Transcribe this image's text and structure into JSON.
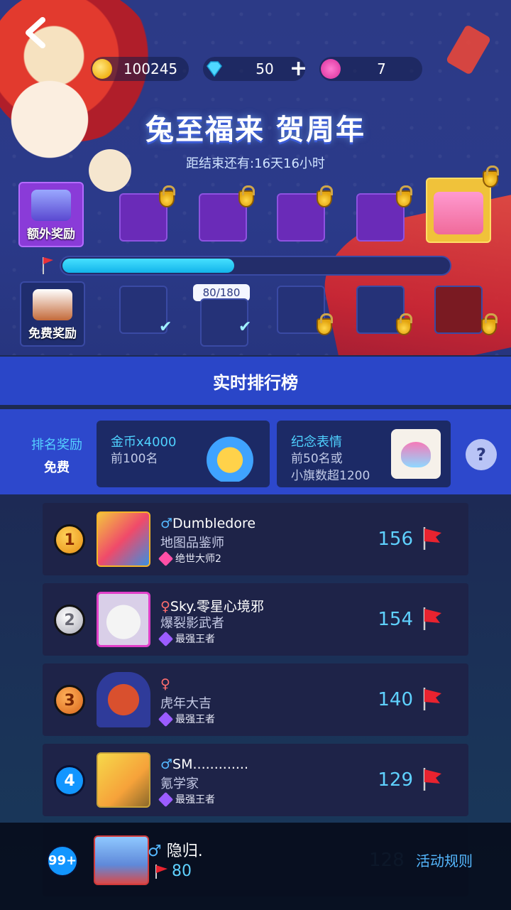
{
  "header": {
    "back_icon": "back-arrow-icon",
    "currencies": [
      {
        "icon": "gold-coin-icon",
        "value": "100245"
      },
      {
        "icon": "diamond-icon",
        "value": "50"
      },
      {
        "icon": "lotus-icon",
        "value": "7"
      }
    ],
    "add_label": "+"
  },
  "event": {
    "title": "兔至福来 贺周年",
    "countdown": "距结束还有:16天16小时"
  },
  "rewards": {
    "extra_label": "额外奖励",
    "free_label": "免费奖励",
    "progress_text": "80/180",
    "progress_current": 80,
    "progress_max": 180
  },
  "leaderboard": {
    "title": "实时排行榜",
    "rank_reward_label": "排名奖励",
    "rank_reward_price": "免费",
    "reward_cards": [
      {
        "title": "金币x4000",
        "sub": "前100名",
        "icon": "treasure-chest-icon"
      },
      {
        "title": "纪念表情",
        "sub": "前50名或\n小旗数超1200",
        "icon": "emote-icon"
      }
    ],
    "help_label": "?",
    "rows": [
      {
        "rank": "1",
        "gender": "♂",
        "name": "Dumbledore",
        "title": "地图品鉴师",
        "tier": "绝世大师2",
        "score": "156"
      },
      {
        "rank": "2",
        "gender": "♀",
        "name": "Sky.零星心境邪",
        "title": "爆裂影武者",
        "tier": "最强王者",
        "score": "154"
      },
      {
        "rank": "3",
        "gender": "♀",
        "name": "",
        "title": "虎年大吉",
        "tier": "最强王者",
        "score": "140"
      },
      {
        "rank": "4",
        "gender": "♂",
        "name": "SM.............",
        "title": "氪学家",
        "tier": "最强王者",
        "score": "129"
      }
    ]
  },
  "self": {
    "rank": "99+",
    "gender": "♂",
    "name": "隐归.",
    "flags": "80",
    "ghost_score": "128",
    "rules_label": "活动规则"
  },
  "colors": {
    "accent_blue": "#2a46c8",
    "score_cyan": "#5fd1ff",
    "male_blue": "#55b8ff",
    "female_red": "#ff6e6e"
  }
}
